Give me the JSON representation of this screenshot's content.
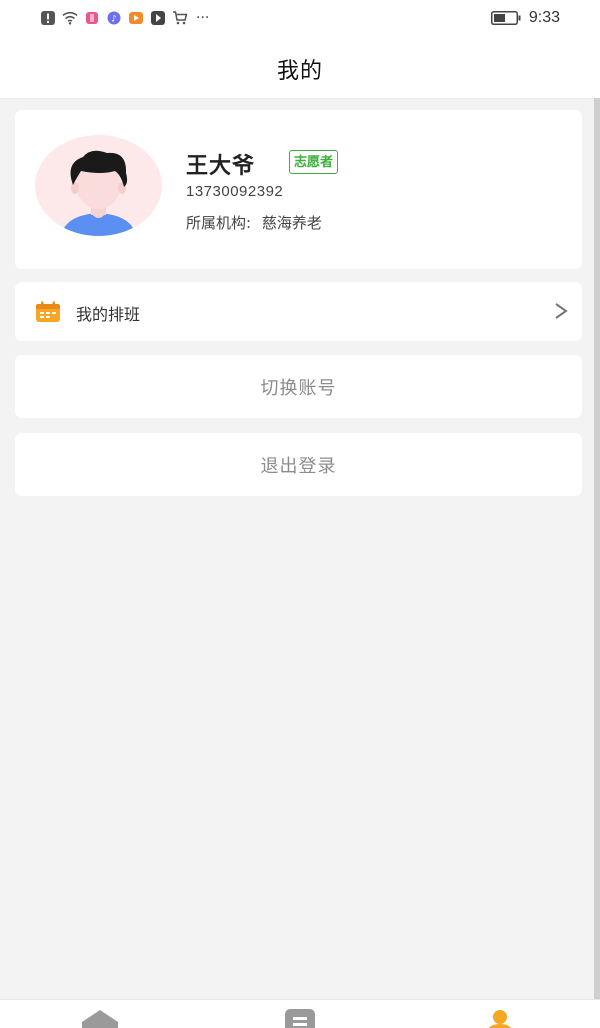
{
  "status_bar": {
    "time": "9:33",
    "overflow": "···",
    "icons": [
      "alert-icon",
      "wifi-icon",
      "app-icon",
      "music-icon",
      "video-icon",
      "app-icon",
      "cart-icon"
    ]
  },
  "header": {
    "title": "我的"
  },
  "profile": {
    "name": "王大爷",
    "badge": "志愿者",
    "phone": "13730092392",
    "org_label": "所属机构:",
    "org_name": "慈海养老",
    "avatar": "avatar-icon"
  },
  "menu": {
    "schedule_label": "我的排班",
    "schedule_icon": "calendar-icon",
    "chevron": "chevron-right-icon"
  },
  "actions": {
    "switch_account": "切换账号",
    "logout": "退出登录"
  },
  "tabs": [
    {
      "icon": "home-icon",
      "active": false
    },
    {
      "icon": "list-icon",
      "active": false
    },
    {
      "icon": "user-icon",
      "active": true
    }
  ],
  "colors": {
    "badge_green": "#3fae3f",
    "accent_orange": "#f5a623",
    "background": "#f3f3f3",
    "action_text": "#8c8c8c"
  }
}
